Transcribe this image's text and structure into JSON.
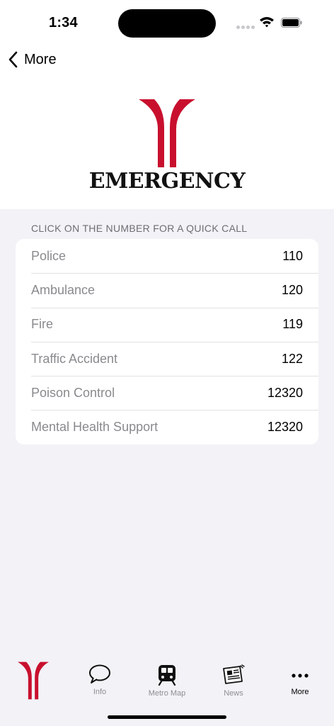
{
  "status": {
    "time": "1:34"
  },
  "nav": {
    "back_label": "More"
  },
  "logo": {
    "wordmark": "EMERGENCY"
  },
  "section": {
    "header": "CLICK ON THE NUMBER FOR A QUICK CALL"
  },
  "contacts": [
    {
      "name": "Police",
      "number": "110"
    },
    {
      "name": "Ambulance",
      "number": "120"
    },
    {
      "name": "Fire",
      "number": "119"
    },
    {
      "name": "Traffic Accident",
      "number": "122"
    },
    {
      "name": "Poison Control",
      "number": "12320"
    },
    {
      "name": "Mental Health Support",
      "number": "12320"
    }
  ],
  "tabs": [
    {
      "label": "",
      "icon": "app-logo-icon"
    },
    {
      "label": "Info",
      "icon": "speech-bubble-icon"
    },
    {
      "label": "Metro Map",
      "icon": "metro-train-icon"
    },
    {
      "label": "News",
      "icon": "newspaper-icon"
    },
    {
      "label": "More",
      "icon": "more-dots-icon"
    }
  ],
  "colors": {
    "brand_red": "#c8102e",
    "background": "#f2f2f7"
  }
}
